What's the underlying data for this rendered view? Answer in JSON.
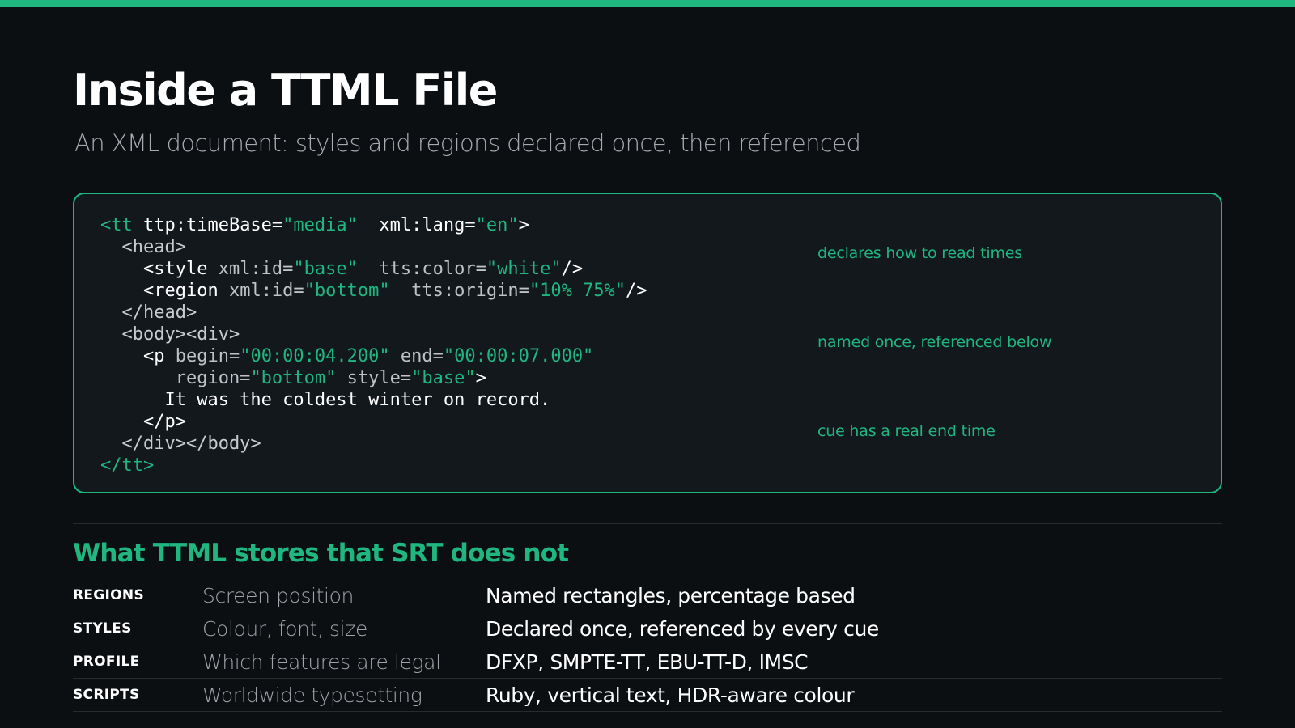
{
  "slide": {
    "title": "Inside a TTML File",
    "subtitle": "An XML document: styles and regions declared once, then referenced"
  },
  "code": {
    "lines": [
      [
        [
          "gtag",
          "<tt "
        ],
        [
          "tag",
          "ttp:timeBase="
        ],
        [
          "val",
          "\"media\""
        ],
        [
          "tag",
          "  xml:lang="
        ],
        [
          "val",
          "\"en\""
        ],
        [
          "punct",
          ">"
        ]
      ],
      [
        [
          "dtag",
          "  <head>"
        ]
      ],
      [
        [
          "tag",
          "    <style "
        ],
        [
          "attr",
          "xml:id="
        ],
        [
          "val",
          "\"base\""
        ],
        [
          "attr",
          "  tts:color="
        ],
        [
          "val",
          "\"white\""
        ],
        [
          "punct",
          "/>"
        ]
      ],
      [
        [
          "tag",
          "    <region "
        ],
        [
          "attr",
          "xml:id="
        ],
        [
          "val",
          "\"bottom\""
        ],
        [
          "attr",
          "  tts:origin="
        ],
        [
          "val",
          "\"10% 75%\""
        ],
        [
          "punct",
          "/>"
        ]
      ],
      [
        [
          "dtag",
          "  </head>"
        ]
      ],
      [
        [
          "dtag",
          "  <body><div>"
        ]
      ],
      [
        [
          "tag",
          "    <p "
        ],
        [
          "attr",
          "begin="
        ],
        [
          "val",
          "\"00:00:04.200\""
        ],
        [
          "attr",
          " end="
        ],
        [
          "val",
          "\"00:00:07.000\""
        ]
      ],
      [
        [
          "attr",
          "       region="
        ],
        [
          "val",
          "\"bottom\""
        ],
        [
          "attr",
          " style="
        ],
        [
          "val",
          "\"base\""
        ],
        [
          "punct",
          ">"
        ]
      ],
      [
        [
          "text",
          "      It was the coldest winter on record."
        ]
      ],
      [
        [
          "tag",
          "    </p>"
        ]
      ],
      [
        [
          "dtag",
          "  </div></body>"
        ]
      ],
      [
        [
          "gtag",
          "</tt>"
        ]
      ]
    ],
    "annotations": [
      "declares how to read times",
      "named once, referenced below",
      "cue has a real end time"
    ]
  },
  "section": {
    "heading": "What TTML stores that SRT does not"
  },
  "features": [
    {
      "key": "REGIONS",
      "label": "Screen position",
      "value": "Named rectangles, percentage based"
    },
    {
      "key": "STYLES",
      "label": "Colour, font, size",
      "value": "Declared once, referenced by every cue"
    },
    {
      "key": "PROFILE",
      "label": "Which features are legal",
      "value": "DFXP, SMPTE-TT, EBU-TT-D, IMSC"
    },
    {
      "key": "SCRIPTS",
      "label": "Worldwide typesetting",
      "value": "Ruby, vertical text, HDR-aware colour"
    }
  ],
  "colors": {
    "accent": "#1fb67f",
    "background": "#0b0f12",
    "panel": "#13181d"
  }
}
